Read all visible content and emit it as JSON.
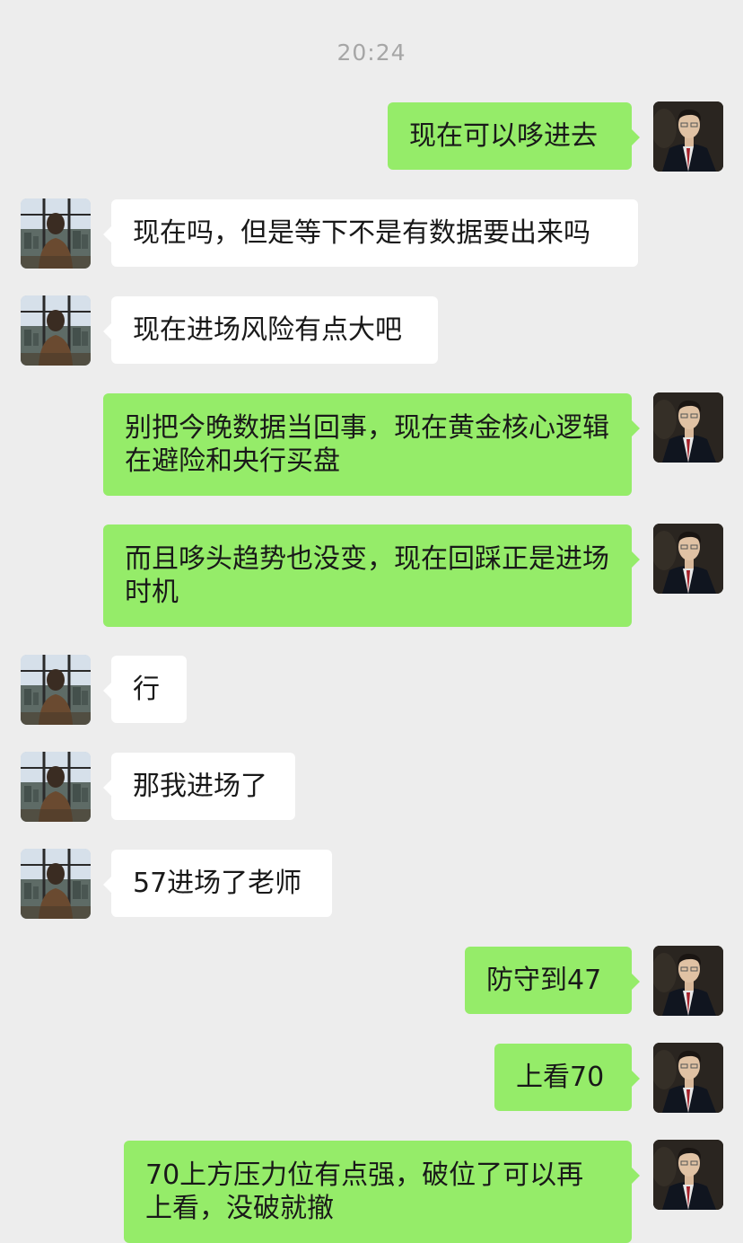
{
  "chat": {
    "timestamp": "20:24",
    "messages": [
      {
        "from": "me",
        "text": "现在可以哆进去"
      },
      {
        "from": "other",
        "text": "现在吗，但是等下不是有数据要出来吗"
      },
      {
        "from": "other",
        "text": "现在进场风险有点大吧"
      },
      {
        "from": "me",
        "text": "别把今晚数据当回事，现在黄金核心逻辑在避险和央行买盘"
      },
      {
        "from": "me",
        "text": "而且哆头趋势也没变，现在回踩正是进场时机"
      },
      {
        "from": "other",
        "text": "行"
      },
      {
        "from": "other",
        "text": "那我进场了"
      },
      {
        "from": "other",
        "text": "57进场了老师"
      },
      {
        "from": "me",
        "text": "防守到47"
      },
      {
        "from": "me",
        "text": "上看70"
      },
      {
        "from": "me",
        "text": "70上方压力位有点强，破位了可以再上看，没破就撤"
      }
    ]
  },
  "theme": {
    "background": "#ededed",
    "outgoing_bubble": "#95ec69",
    "incoming_bubble": "#ffffff",
    "text": "#191919",
    "timestamp_text": "#a6a6a6"
  }
}
